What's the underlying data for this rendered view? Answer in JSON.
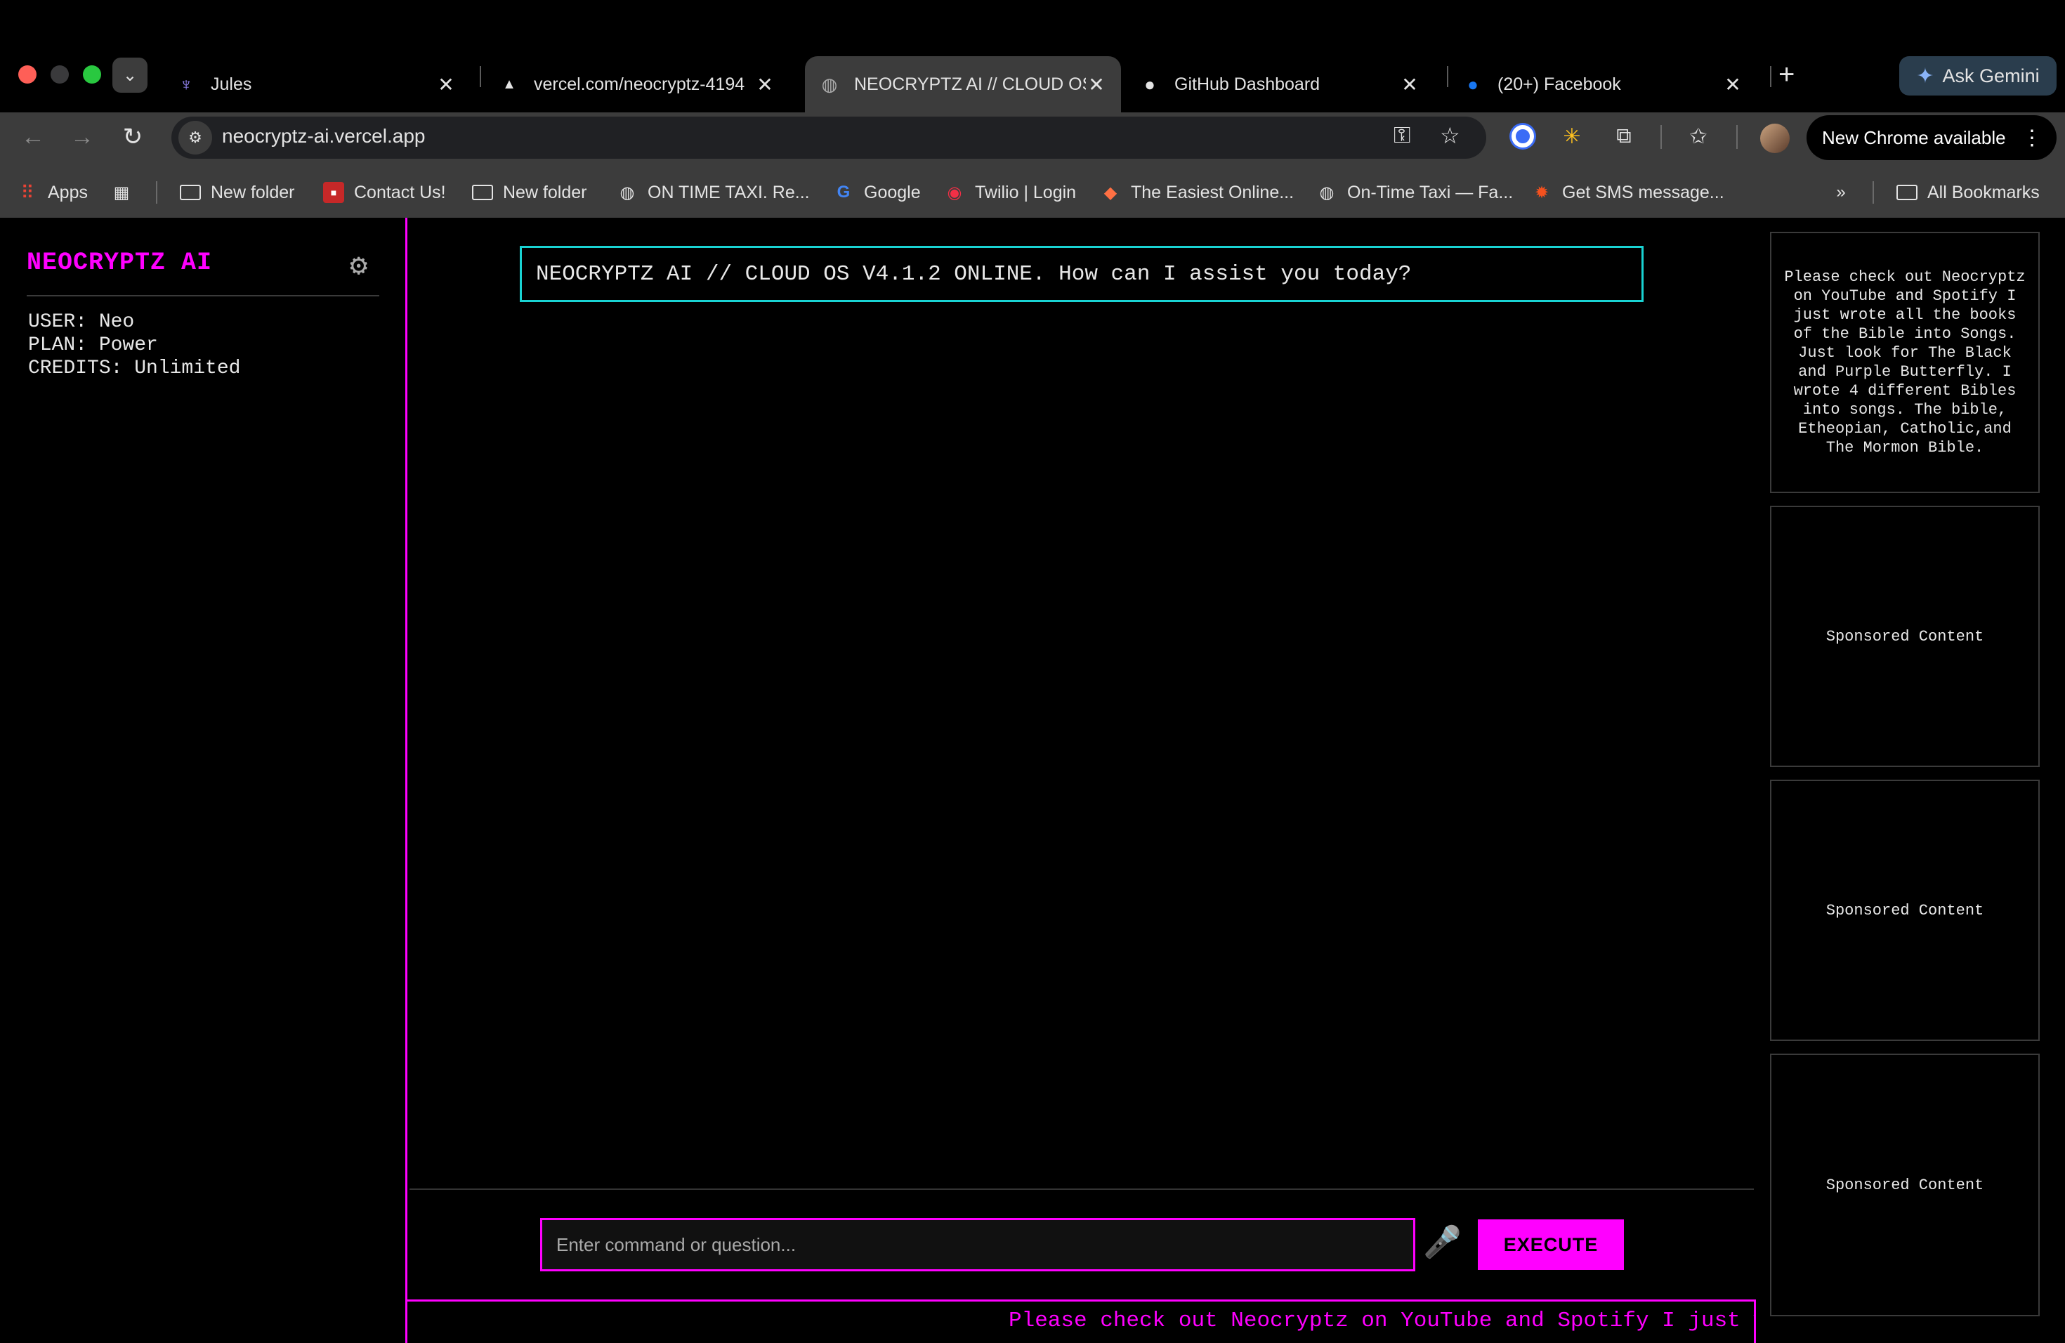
{
  "browser": {
    "tabs": [
      {
        "title": "Jules",
        "icon": "jules-octopus-icon",
        "active": false
      },
      {
        "title": "vercel.com/neocryptz-4194",
        "icon": "vercel-triangle-icon",
        "active": false
      },
      {
        "title": "NEOCRYPTZ AI // CLOUD OS",
        "icon": "globe-icon",
        "active": true
      },
      {
        "title": "GitHub Dashboard",
        "icon": "github-icon",
        "active": false
      },
      {
        "title": "(20+) Facebook",
        "icon": "facebook-icon",
        "active": false
      }
    ],
    "gemini_label": "Ask Gemini",
    "url": "neocryptz-ai.vercel.app",
    "new_chrome_label": "New Chrome available",
    "bookmarks": [
      {
        "label": "Apps",
        "icon": "apps-grid-icon"
      },
      {
        "label": "New folder",
        "icon": "folder-icon"
      },
      {
        "label": "Contact Us!",
        "icon": "site-favicon"
      },
      {
        "label": "New folder",
        "icon": "folder-icon"
      },
      {
        "label": "ON TIME TAXI. Re...",
        "icon": "globe-icon"
      },
      {
        "label": "Google",
        "icon": "google-icon"
      },
      {
        "label": "Twilio | Login",
        "icon": "twilio-icon"
      },
      {
        "label": "The Easiest Online...",
        "icon": "site-favicon"
      },
      {
        "label": "On-Time Taxi — Fa...",
        "icon": "globe-icon"
      },
      {
        "label": "Get SMS message...",
        "icon": "site-favicon"
      }
    ],
    "all_bookmarks_label": "All Bookmarks"
  },
  "app": {
    "logo": "NEOCRYPTZ AI",
    "user_line": "USER: Neo",
    "plan_line": "PLAN: Power",
    "credits_line": "CREDITS: Unlimited",
    "welcome_message": "NEOCRYPTZ AI // CLOUD OS V4.1.2 ONLINE. How can I assist you today?",
    "input_placeholder": "Enter command or question...",
    "execute_label": "EXECUTE",
    "ticker_text": "Please check out Neocryptz on YouTube and Spotify I just wrote all the books of the Bible into Songs.",
    "promo_text": "Please check out Neocryptz on YouTube and Spotify I just wrote all the books of the Bible into Songs. Just look for The Black and Purple Butterfly. I wrote 4 different Bibles into songs. The bible, Etheopian, Catholic,and The Mormon Bible.",
    "ad_label_1": "Sponsored Content",
    "ad_label_2": "Sponsored Content",
    "ad_label_3": "Sponsored Content"
  },
  "colors": {
    "accent": "#ff00ff",
    "welcome_border": "#19d3d3",
    "background": "#000000"
  }
}
